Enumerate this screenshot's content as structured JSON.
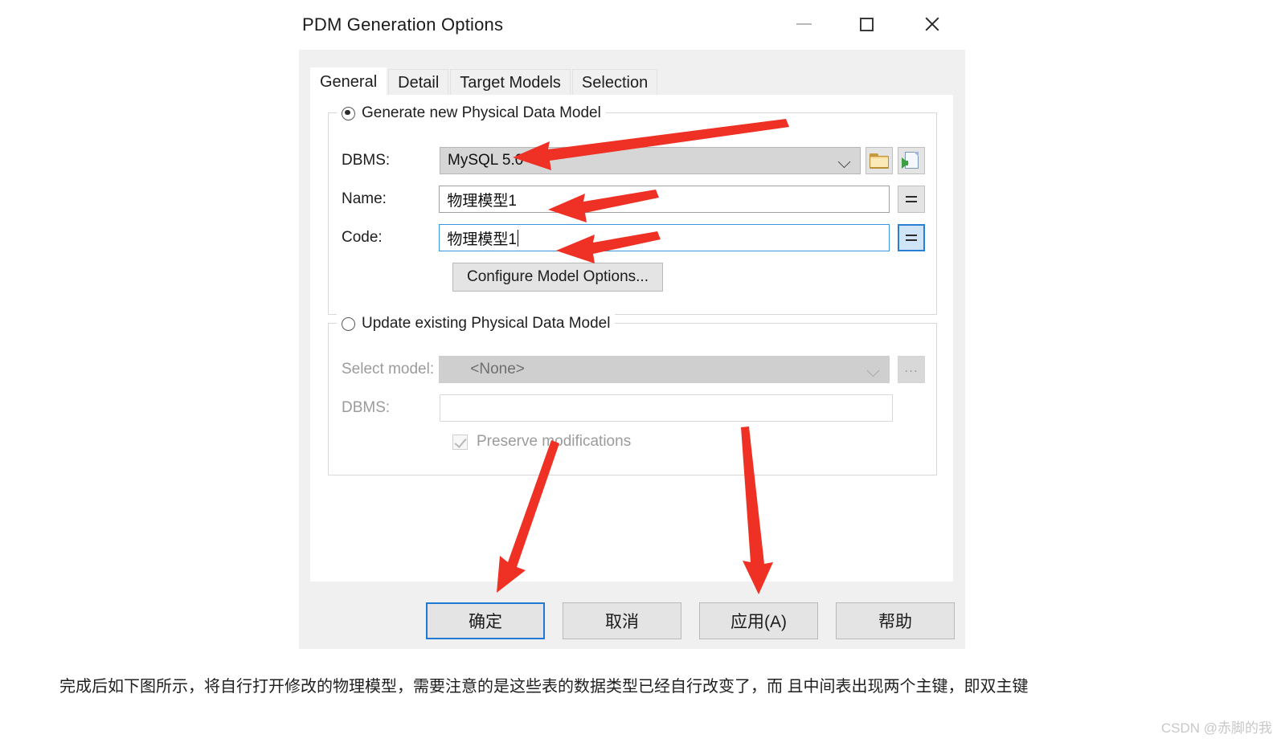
{
  "dialog": {
    "title": "PDM Generation Options",
    "window_controls": {
      "minimize": "minimize",
      "maximize": "maximize",
      "close": "close"
    },
    "tabs": [
      {
        "label": "General",
        "active": true
      },
      {
        "label": "Detail",
        "active": false
      },
      {
        "label": "Target Models",
        "active": false
      },
      {
        "label": "Selection",
        "active": false
      }
    ],
    "generate_group": {
      "radio_label": "Generate new Physical Data Model",
      "radio_selected": true,
      "dbms": {
        "label": "DBMS:",
        "value": "MySQL 5.0",
        "browse_icon": "folder-icon",
        "import_icon": "document-import-icon"
      },
      "name": {
        "label": "Name:",
        "value": "物理模型1",
        "equals_button": "="
      },
      "code": {
        "label": "Code:",
        "value": "物理模型1",
        "equals_button": "=",
        "focused": true
      },
      "configure_button": "Configure Model Options..."
    },
    "update_group": {
      "radio_label": "Update existing Physical Data Model",
      "radio_selected": false,
      "select_model": {
        "label": "Select model:",
        "value": "<None>",
        "browse_button": "..."
      },
      "dbms": {
        "label": "DBMS:",
        "value": ""
      },
      "preserve": {
        "label": "Preserve modifications",
        "checked": true,
        "disabled": true
      }
    },
    "buttons": [
      {
        "label": "确定",
        "default": true
      },
      {
        "label": "取消",
        "default": false
      },
      {
        "label": "应用(A)",
        "default": false
      },
      {
        "label": "帮助",
        "default": false
      }
    ]
  },
  "annotations": {
    "accent_color": "#ee3124",
    "arrows": [
      {
        "name": "arrow-to-dbms-combo",
        "direction": "left"
      },
      {
        "name": "arrow-to-name-field",
        "direction": "left"
      },
      {
        "name": "arrow-to-code-field",
        "direction": "left"
      },
      {
        "name": "arrow-to-ok-button",
        "direction": "down"
      },
      {
        "name": "arrow-to-apply-button",
        "direction": "down"
      }
    ]
  },
  "caption": {
    "text": "完成后如下图所示，将自行打开修改的物理模型，需要注意的是这些表的数据类型已经自行改变了，而 且中间表出现两个主键，即双主键"
  },
  "watermark": {
    "text": "CSDN @赤脚的我"
  }
}
